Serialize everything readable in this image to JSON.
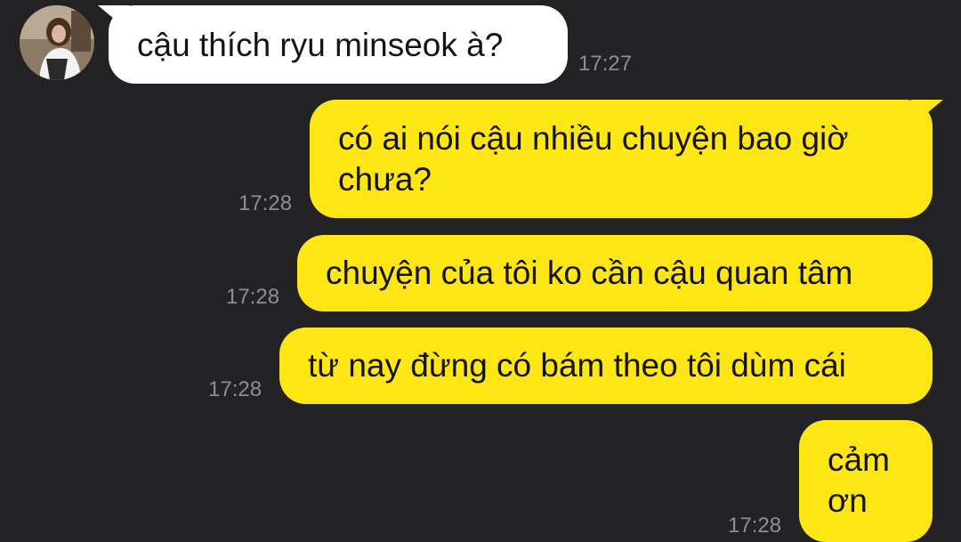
{
  "colors": {
    "background": "#232325",
    "incoming_bubble": "#ffffff",
    "outgoing_bubble": "#fde614",
    "timestamp": "#8e8e93"
  },
  "avatar_icon": "contact-profile-photo",
  "messages": [
    {
      "direction": "incoming",
      "lines": [
        "cậu thích ryu minseok à?"
      ],
      "time": "17:27"
    },
    {
      "direction": "outgoing",
      "lines": [
        "có ai nói cậu nhiều chuyện bao giờ",
        "chưa?"
      ],
      "time": "17:28"
    },
    {
      "direction": "outgoing",
      "lines": [
        "chuyện của tôi ko cần cậu quan tâm"
      ],
      "time": "17:28"
    },
    {
      "direction": "outgoing",
      "lines": [
        "từ nay đừng có bám theo tôi dùm cái"
      ],
      "time": "17:28"
    },
    {
      "direction": "outgoing",
      "lines": [
        "cảm",
        "ơn"
      ],
      "time": "17:28"
    }
  ]
}
